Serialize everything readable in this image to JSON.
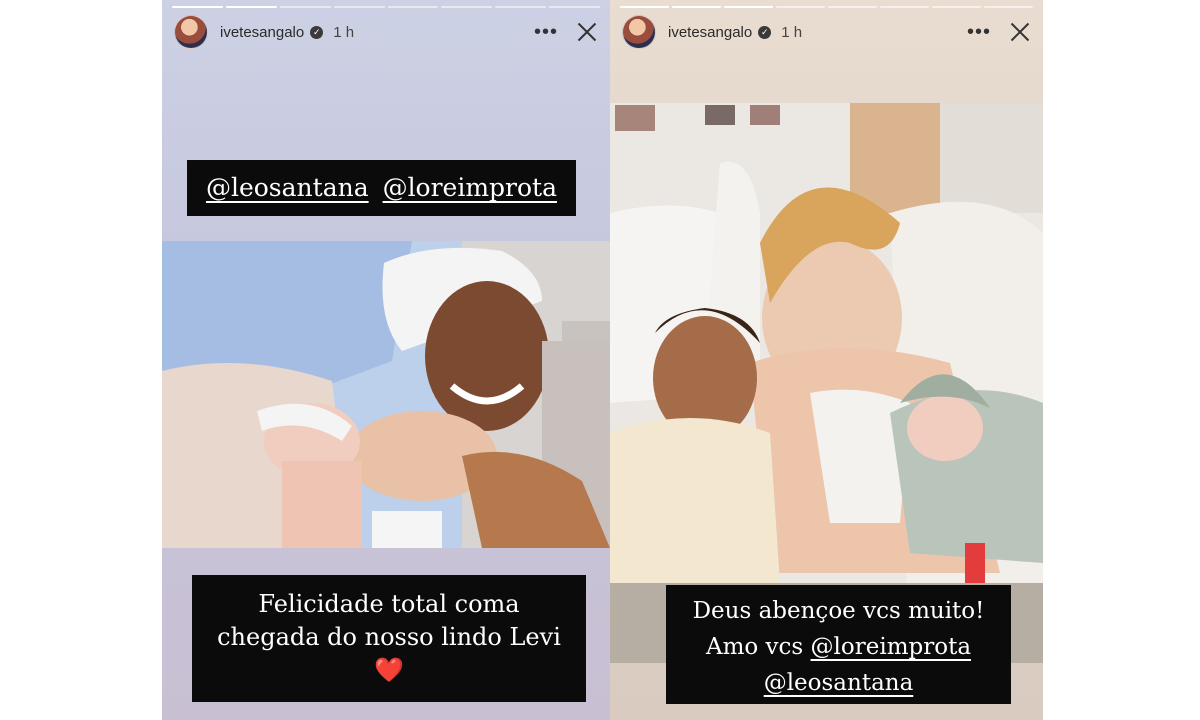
{
  "left_story": {
    "username": "ivetesangalo",
    "time": "1 h",
    "progress_total": 8,
    "progress_done": 2,
    "mentions": [
      "@leosantana",
      "@loreimprota"
    ],
    "caption_line1": "Felicidade total coma",
    "caption_line2": "chegada do nosso lindo Levi",
    "heart": "❤️"
  },
  "right_story": {
    "username": "ivetesangalo",
    "time": "1 h",
    "progress_total": 8,
    "progress_done": 3,
    "caption_line1": "Deus abençoe vcs muito!",
    "caption_line2_prefix": "Amo vcs",
    "mention_1": "@loreimprota",
    "mention_2": "@leosantana"
  },
  "icons": {
    "verified": "verified-badge-icon",
    "more": "more-options-icon",
    "close": "close-icon"
  },
  "colors": {
    "caption_bg": "#0b0b0b",
    "caption_text": "#ffffff",
    "heart": "#e0252f"
  }
}
